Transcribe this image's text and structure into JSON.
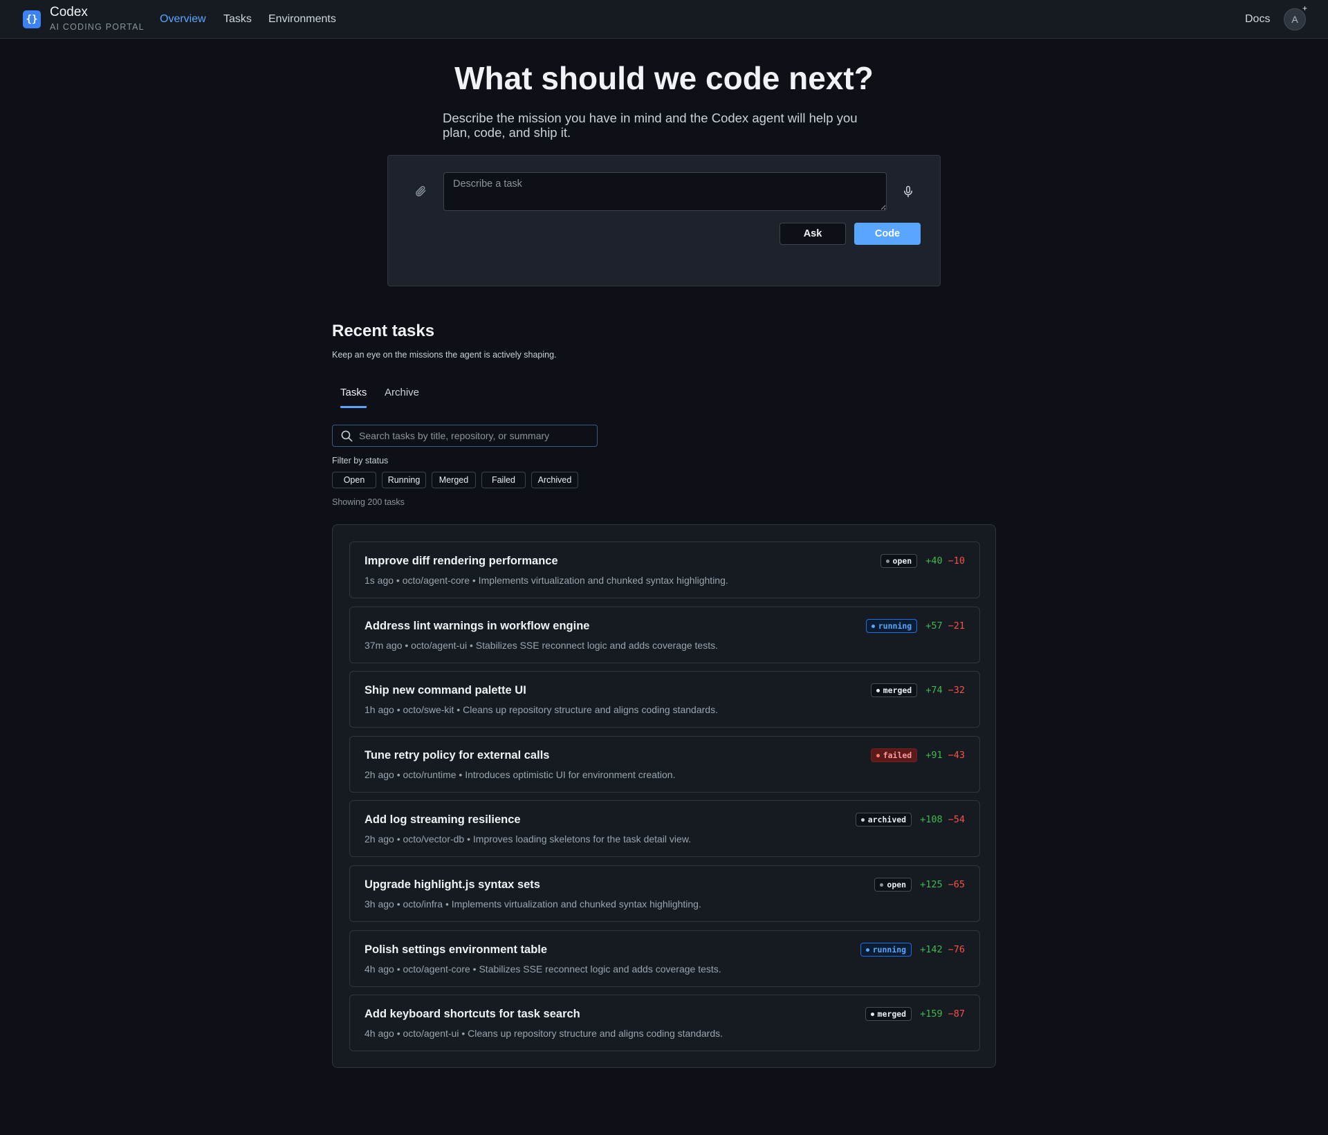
{
  "brand": {
    "logo_glyph": "{}",
    "name": "Codex",
    "subtitle": "AI CODING PORTAL",
    "accent": "#3b82f6"
  },
  "nav": {
    "items": [
      {
        "label": "Overview",
        "active": true
      },
      {
        "label": "Tasks",
        "active": false
      },
      {
        "label": "Environments",
        "active": false
      }
    ],
    "docs": "Docs",
    "avatar_initial": "A",
    "avatar_badge": "+"
  },
  "hero": {
    "title": "What should we code next?",
    "subtitle": "Describe the mission you have in mind and the Codex agent will help you plan, code, and ship it."
  },
  "composer": {
    "placeholder": "Describe a task",
    "value": "",
    "ask_label": "Ask",
    "code_label": "Code",
    "attach_icon": "paperclip-icon",
    "mic_icon": "microphone-icon"
  },
  "recent": {
    "title": "Recent tasks",
    "subtitle": "Keep an eye on the missions the agent is actively shaping.",
    "tabs": [
      {
        "label": "Tasks",
        "active": true
      },
      {
        "label": "Archive",
        "active": false
      }
    ],
    "search_placeholder": "Search tasks by title, repository, or summary",
    "filter_label": "Filter by status",
    "filters": [
      "Open",
      "Running",
      "Merged",
      "Failed",
      "Archived"
    ],
    "showing": "Showing 200 tasks"
  },
  "tasks": [
    {
      "title": "Improve diff rendering performance",
      "meta": "1s ago • octo/agent-core • Implements virtualization and chunked syntax highlighting.",
      "status": "open",
      "additions": "+40",
      "deletions": "−10"
    },
    {
      "title": "Address lint warnings in workflow engine",
      "meta": "37m ago • octo/agent-ui • Stabilizes SSE reconnect logic and adds coverage tests.",
      "status": "running",
      "additions": "+57",
      "deletions": "−21"
    },
    {
      "title": "Ship new command palette UI",
      "meta": "1h ago • octo/swe-kit • Cleans up repository structure and aligns coding standards.",
      "status": "merged",
      "additions": "+74",
      "deletions": "−32"
    },
    {
      "title": "Tune retry policy for external calls",
      "meta": "2h ago • octo/runtime • Introduces optimistic UI for environment creation.",
      "status": "failed",
      "additions": "+91",
      "deletions": "−43"
    },
    {
      "title": "Add log streaming resilience",
      "meta": "2h ago • octo/vector-db • Improves loading skeletons for the task detail view.",
      "status": "archived",
      "additions": "+108",
      "deletions": "−54"
    },
    {
      "title": "Upgrade highlight.js syntax sets",
      "meta": "3h ago • octo/infra • Implements virtualization and chunked syntax highlighting.",
      "status": "open",
      "additions": "+125",
      "deletions": "−65"
    },
    {
      "title": "Polish settings environment table",
      "meta": "4h ago • octo/agent-core • Stabilizes SSE reconnect logic and adds coverage tests.",
      "status": "running",
      "additions": "+142",
      "deletions": "−76"
    },
    {
      "title": "Add keyboard shortcuts for task search",
      "meta": "4h ago • octo/agent-ui • Cleans up repository structure and aligns coding standards.",
      "status": "merged",
      "additions": "+159",
      "deletions": "−87"
    }
  ]
}
